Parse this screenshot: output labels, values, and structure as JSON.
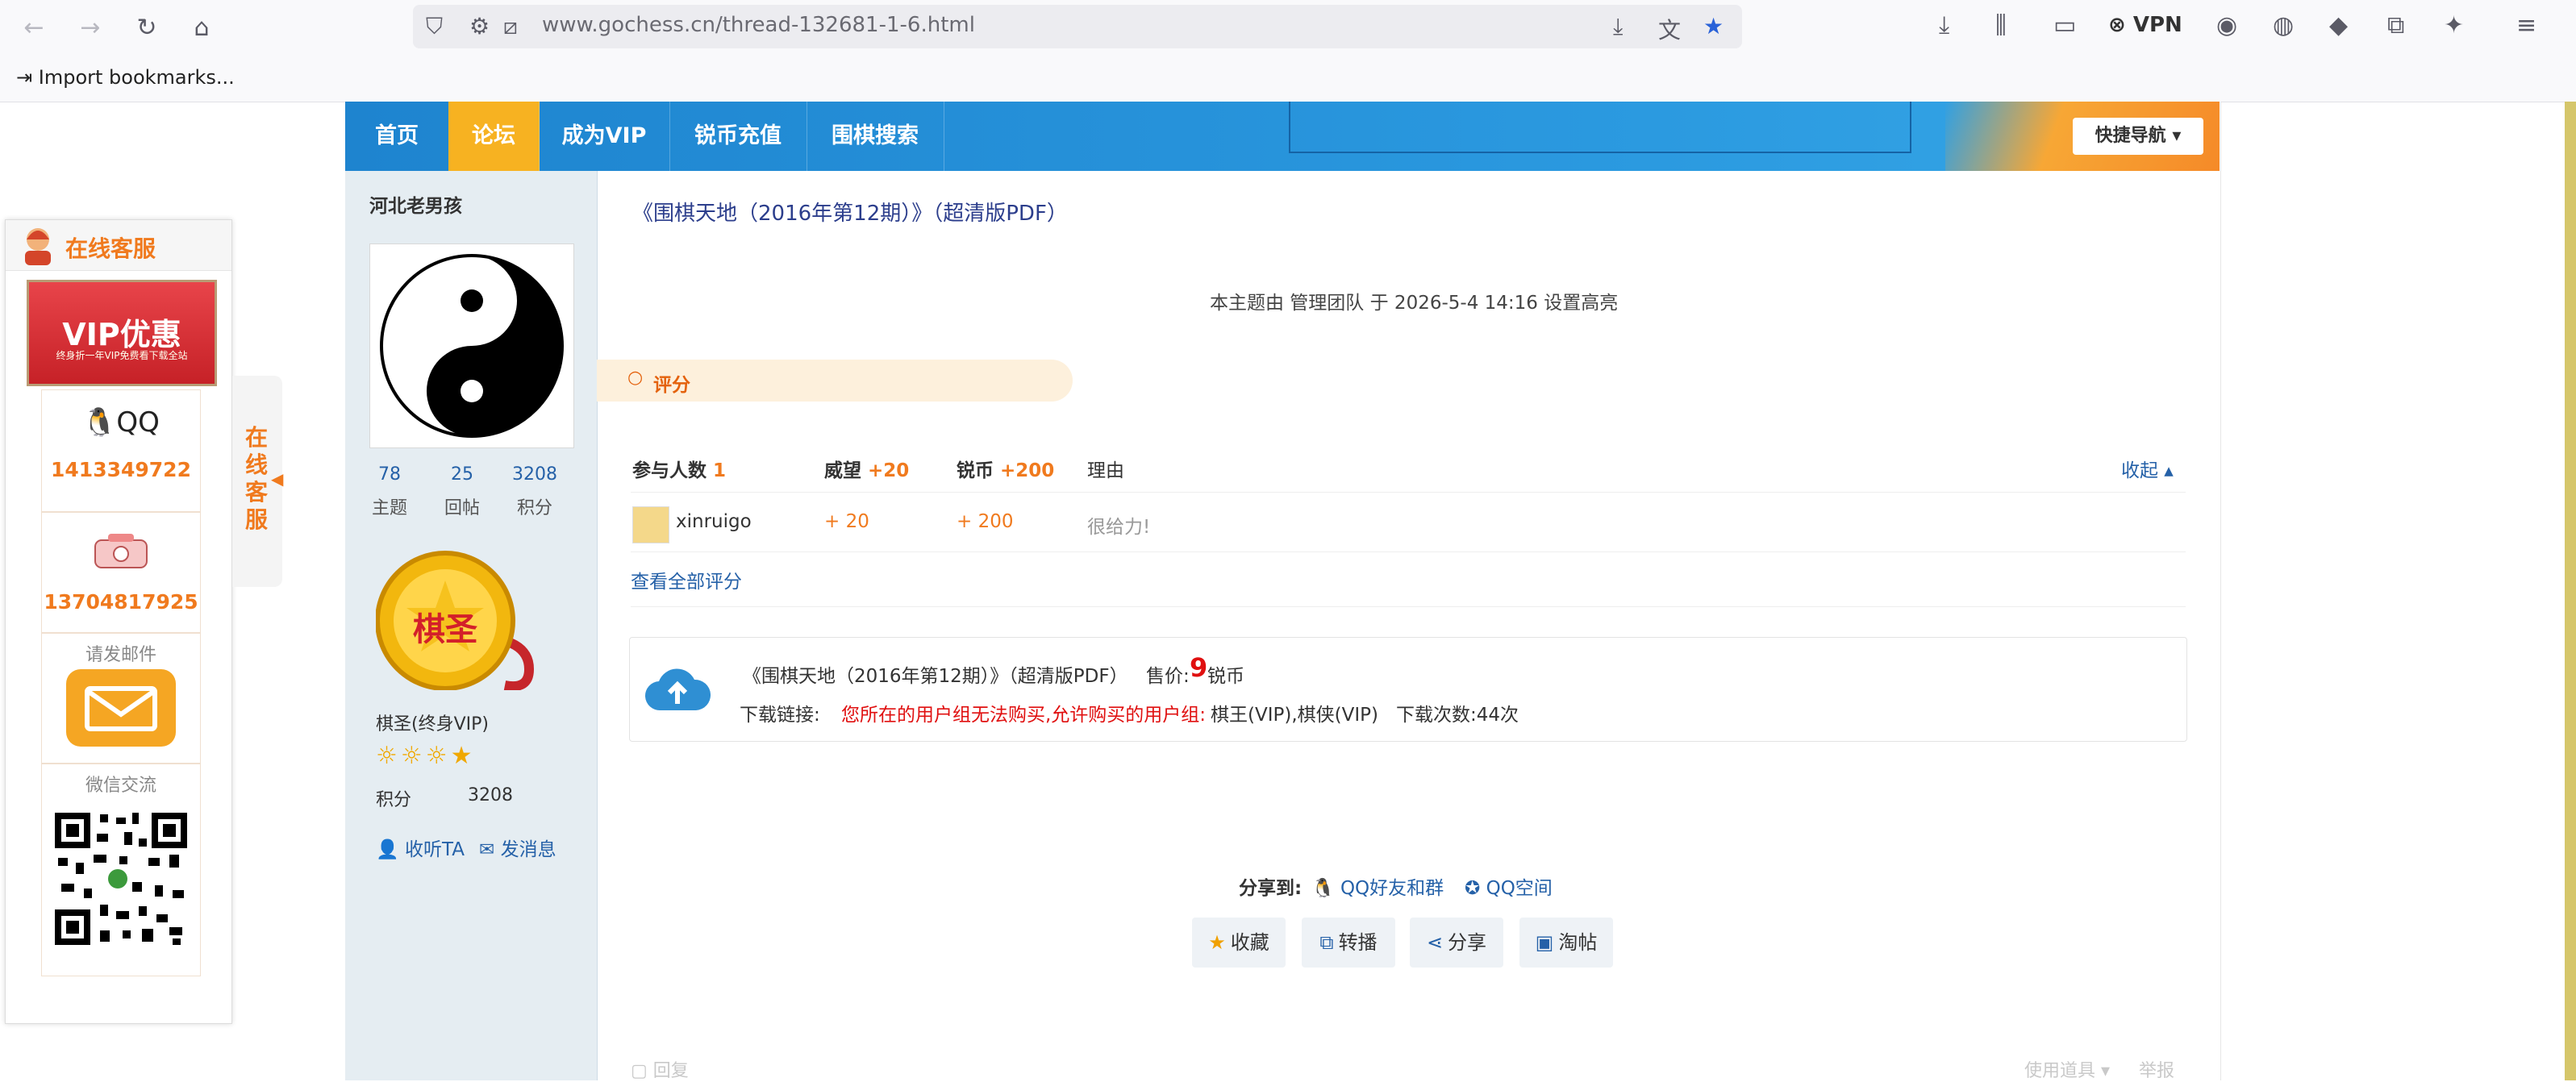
{
  "browser": {
    "url": "www.gochess.cn/thread-132681-1-6.html",
    "bookmark_import": "Import bookmarks...",
    "vpn_label": "VPN"
  },
  "site_nav": {
    "items": [
      "首页",
      "论坛",
      "成为VIP",
      "锐币充值",
      "围棋搜索"
    ],
    "active_index": 1,
    "quick_nav": "快捷导航"
  },
  "service_panel": {
    "title": "在线客服",
    "vip_banner": "VIP优惠",
    "vip_banner_sub": "终身折一年VIP免费看下载全站",
    "qq_label": "QQ",
    "qq_number": "1413349722",
    "phone_number": "13704817925",
    "email_label": "请发邮件",
    "wechat_label": "微信交流",
    "side_tab": "在线客服"
  },
  "profile": {
    "username": "河北老男孩",
    "stats": [
      {
        "value": "78",
        "label": "主题"
      },
      {
        "value": "25",
        "label": "回帖"
      },
      {
        "value": "3208",
        "label": "积分"
      }
    ],
    "medal_text": "棋圣",
    "title": "棋圣(终身VIP)",
    "stars": "☼☼☼★",
    "credit_label": "积分",
    "credit_value": "3208",
    "follow": "收听TA",
    "message": "发消息"
  },
  "post": {
    "title": "《围棋天地（2016年第12期）》（超清版PDF）",
    "highlight_note": "本主题由 管理团队 于 2026-5-4 14:16 设置高亮",
    "rate_section": "评分",
    "rate_headers": {
      "participants_label": "参与人数",
      "participants": "1",
      "prestige_label": "威望",
      "prestige": "+20",
      "coin_label": "锐币",
      "coin": "+200",
      "reason_label": "理由",
      "collapse": "收起"
    },
    "rates": [
      {
        "user": "xinruigo",
        "prestige": "+ 20",
        "coin": "+ 200",
        "reason": "很给力!"
      }
    ],
    "view_all": "查看全部评分",
    "download": {
      "title": "《围棋天地（2016年第12期）》（超清版PDF）",
      "price_label": "售价:",
      "price": "9",
      "price_unit": "锐币",
      "link_label": "下载链接:",
      "deny_msg": "您所在的用户组无法购买,允许购买的用户组:",
      "groups": "棋王(VIP),棋侠(VIP)",
      "count": "下载次数:44次"
    },
    "share_label": "分享到:",
    "share_qq_friends": "QQ好友和群",
    "share_qzone": "QQ空间",
    "actions": [
      "收藏",
      "转播",
      "分享",
      "淘帖"
    ],
    "reply": "回复",
    "tools": "使用道具",
    "report": "举报"
  },
  "colors": {
    "nav_blue": "#1e84cf",
    "nav_active": "#f7b221",
    "accent_orange": "#f07a1e",
    "link_blue": "#2561a8",
    "alert_red": "#e01010"
  }
}
